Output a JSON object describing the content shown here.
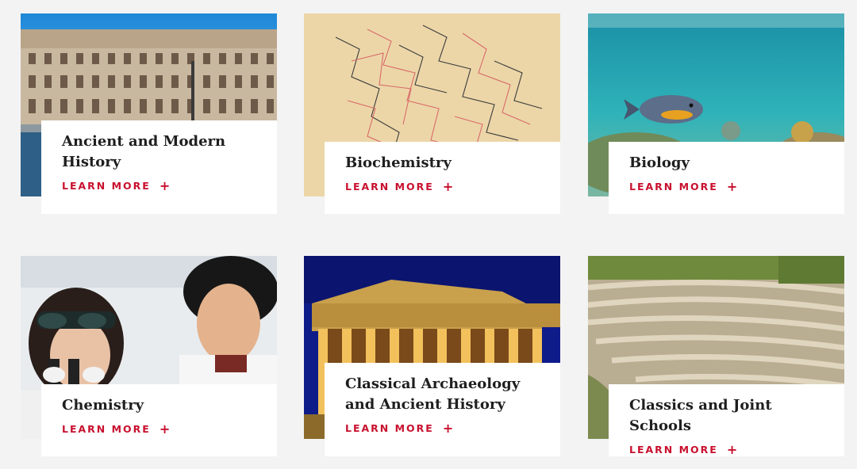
{
  "cards": [
    {
      "title": "Ancient and Modern History",
      "link": "LEARN MORE",
      "link_icon": "+",
      "image": "colosseum"
    },
    {
      "title": "Biochemistry",
      "link": "LEARN MORE",
      "link_icon": "+",
      "image": "molecular-structure"
    },
    {
      "title": "Biology",
      "link": "LEARN MORE",
      "link_icon": "+",
      "image": "fish-coral-reef"
    },
    {
      "title": "Chemistry",
      "link": "LEARN MORE",
      "link_icon": "+",
      "image": "students-microscope"
    },
    {
      "title": "Classical Archaeology and Ancient History",
      "link": "LEARN MORE",
      "link_icon": "+",
      "image": "parthenon-night"
    },
    {
      "title": "Classics and Joint Schools",
      "link": "LEARN MORE",
      "link_icon": "+",
      "image": "ancient-amphitheatre"
    }
  ],
  "colors": {
    "accent": "#c8102e",
    "background": "#f3f3f3",
    "title": "#1f1f1f"
  }
}
